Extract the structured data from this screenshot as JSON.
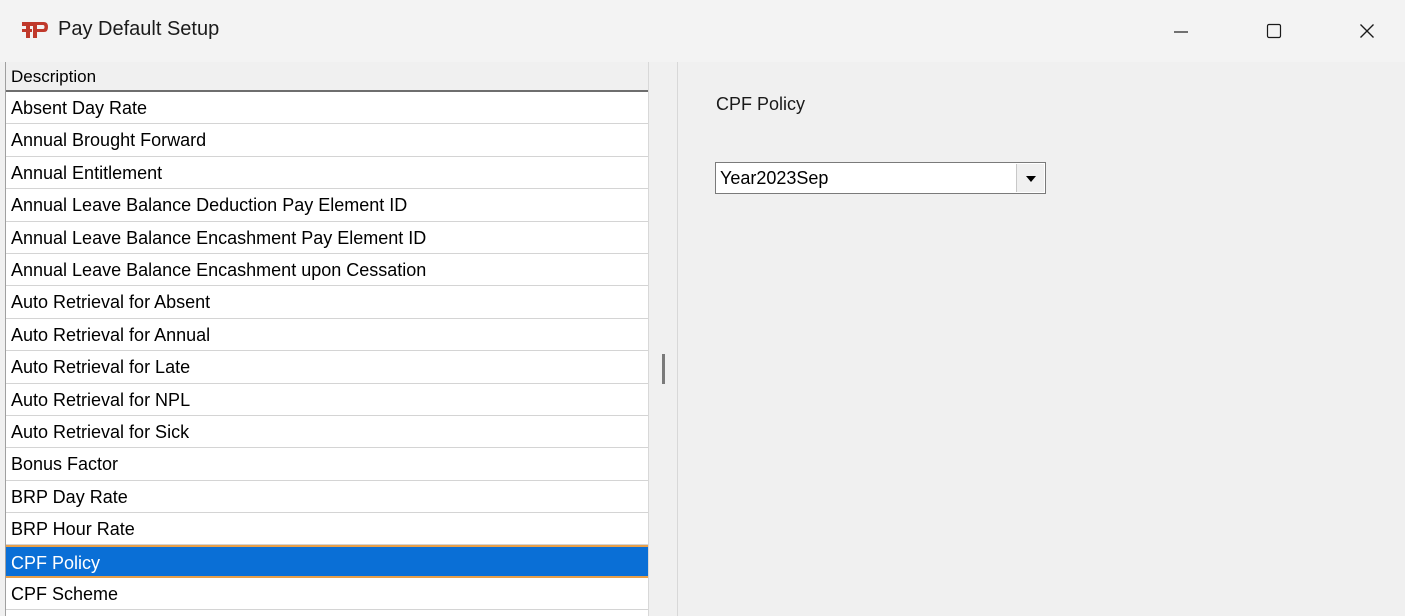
{
  "window": {
    "title": "Pay Default Setup",
    "icon": "app-logo-icon",
    "controls": [
      "minimize-icon",
      "maximize-icon",
      "close-icon"
    ]
  },
  "list": {
    "header": "Description",
    "items": [
      "Absent Day Rate",
      "Annual Brought Forward",
      "Annual Entitlement",
      "Annual Leave Balance Deduction Pay Element ID",
      "Annual Leave Balance Encashment Pay Element ID",
      "Annual Leave Balance Encashment upon Cessation",
      "Auto Retrieval for Absent",
      "Auto Retrieval for Annual",
      "Auto Retrieval for Late",
      "Auto Retrieval for NPL",
      "Auto Retrieval for Sick",
      "Bonus Factor",
      "BRP Day Rate",
      "BRP Hour Rate",
      "CPF Policy",
      "CPF Scheme"
    ],
    "selected_index": 14
  },
  "detail": {
    "label": "CPF Policy",
    "combo_value": "Year2023Sep"
  },
  "colors": {
    "selection_bg": "#0a6fd6",
    "selection_border": "#e8a04a",
    "logo_red": "#c0392b"
  }
}
